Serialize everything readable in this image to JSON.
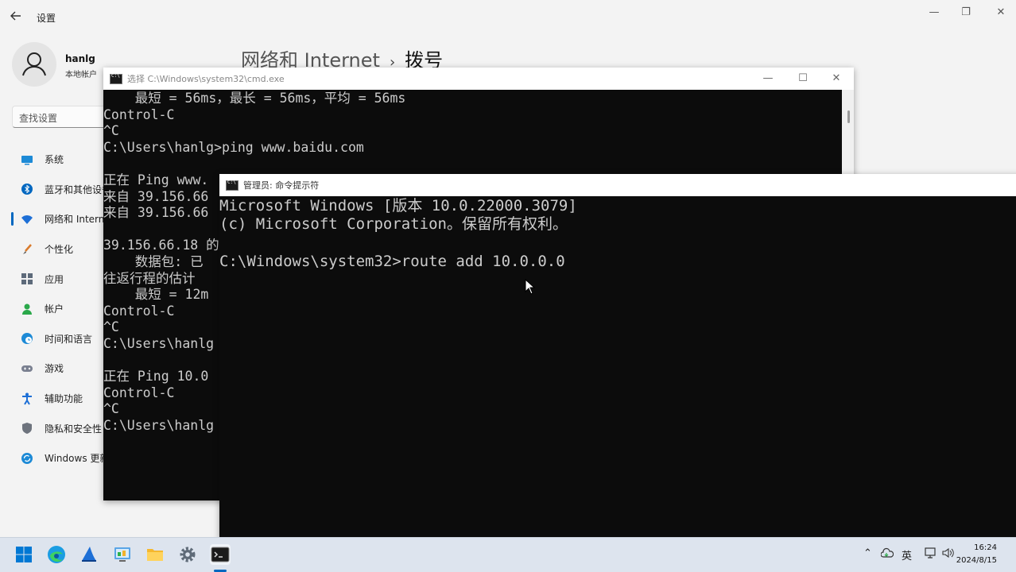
{
  "settings": {
    "title": "设置",
    "user": {
      "name": "hanlg",
      "type": "本地帐户"
    },
    "search_placeholder": "查找设置",
    "nav": [
      {
        "label": "系统",
        "icon": "monitor-icon",
        "color": "#1d8ad6"
      },
      {
        "label": "蓝牙和其他设备",
        "icon": "bluetooth-icon",
        "color": "#0067c0"
      },
      {
        "label": "网络和 Internet",
        "icon": "wifi-icon",
        "color": "#1d6fd6",
        "active": true
      },
      {
        "label": "个性化",
        "icon": "brush-icon",
        "color": "#d97a2b"
      },
      {
        "label": "应用",
        "icon": "apps-icon",
        "color": "#5d6a7a"
      },
      {
        "label": "帐户",
        "icon": "account-icon",
        "color": "#2aa84a"
      },
      {
        "label": "时间和语言",
        "icon": "globe-clock-icon",
        "color": "#1d8ad6"
      },
      {
        "label": "游戏",
        "icon": "gamepad-icon",
        "color": "#7a8090"
      },
      {
        "label": "辅助功能",
        "icon": "accessibility-icon",
        "color": "#1d6fd6"
      },
      {
        "label": "隐私和安全性",
        "icon": "shield-icon",
        "color": "#6d737d"
      },
      {
        "label": "Windows 更新",
        "icon": "update-icon",
        "color": "#1d8ad6"
      }
    ],
    "breadcrumb": {
      "parent": "网络和 Internet",
      "separator": "›",
      "current": "拨号"
    }
  },
  "cmd1": {
    "title": "选择 C:\\Windows\\system32\\cmd.exe",
    "lines": [
      "    最短 = 56ms，最长 = 56ms，平均 = 56ms",
      "Control-C",
      "^C",
      "C:\\Users\\hanlg>ping www.baidu.com",
      "",
      "正在 Ping www.",
      "来自 39.156.66",
      "来自 39.156.66",
      "",
      "39.156.66.18 的",
      "    数据包: 已",
      "往返行程的估计",
      "    最短 = 12m",
      "Control-C",
      "^C",
      "C:\\Users\\hanlg",
      "",
      "正在 Ping 10.0",
      "Control-C",
      "^C",
      "C:\\Users\\hanlg"
    ]
  },
  "cmd2": {
    "title": "管理员: 命令提示符",
    "lines": [
      "Microsoft Windows [版本 10.0.22000.3079]",
      "(c) Microsoft Corporation。保留所有权利。",
      "",
      "C:\\Windows\\system32>route add 10.0.0.0"
    ]
  },
  "taskbar": {
    "apps": [
      {
        "name": "start-button",
        "icon": "windows-logo-icon"
      },
      {
        "name": "edge-app",
        "icon": "edge-icon"
      },
      {
        "name": "app-sail",
        "icon": "sail-icon"
      },
      {
        "name": "control-panel-app",
        "icon": "control-panel-icon"
      },
      {
        "name": "file-explorer-app",
        "icon": "folder-icon"
      },
      {
        "name": "settings-app",
        "icon": "gear-icon"
      },
      {
        "name": "terminal-app",
        "icon": "terminal-icon",
        "active": true
      }
    ],
    "tray": {
      "ime": "英"
    },
    "clock": {
      "time": "16:24",
      "date": "2024/8/15"
    }
  },
  "colors": {
    "accent": "#0067c0",
    "terminal_bg": "#0c0c0c",
    "terminal_text": "#cccccc"
  }
}
